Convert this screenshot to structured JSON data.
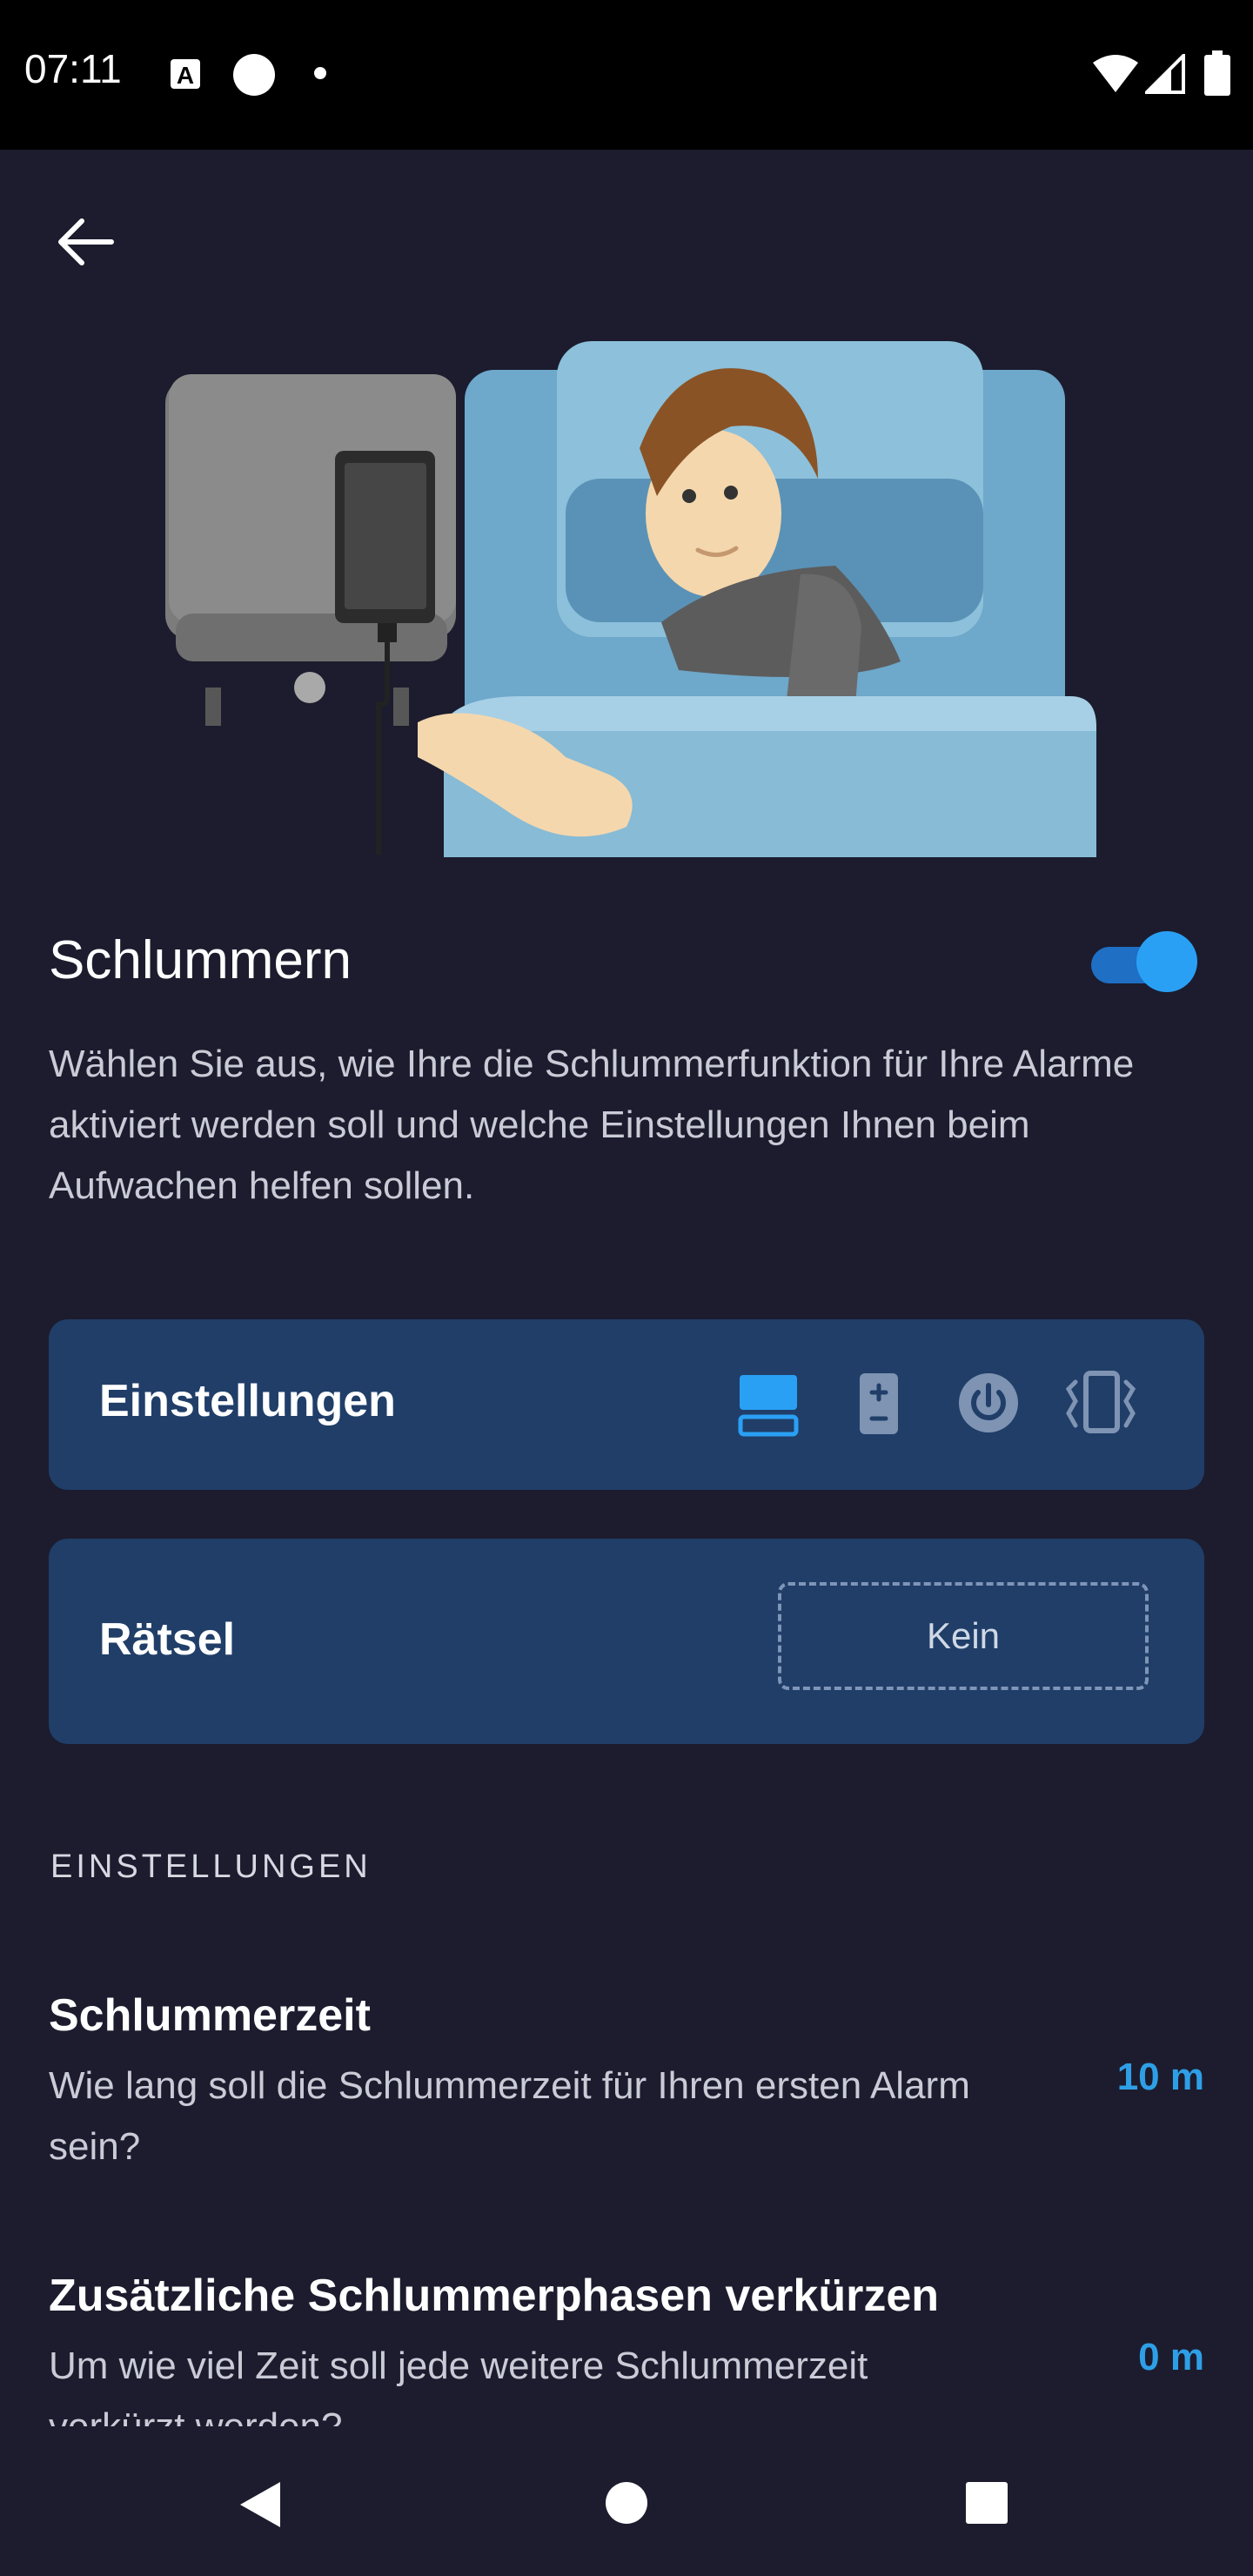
{
  "status_bar": {
    "time": "07:11",
    "icons": [
      "a-font-icon",
      "circle-icon",
      "dot-icon",
      "wifi-icon",
      "signal-icon",
      "battery-icon"
    ]
  },
  "header": {
    "back_icon": "arrow-left-icon"
  },
  "snooze": {
    "title": "Schlummern",
    "enabled": true,
    "description": "Wählen Sie aus, wie Ihre die Schlummerfunktion für Ihre Alarme aktiviert werden soll und welche Einstellungen Ihnen beim Aufwachen helfen sollen."
  },
  "settings_card": {
    "label": "Einstellungen",
    "icons": [
      "screen-button-icon",
      "volume-button-icon",
      "power-button-icon",
      "shake-icon"
    ],
    "active_icon": "screen-button-icon"
  },
  "puzzle_card": {
    "label": "Rätsel",
    "value": "Kein"
  },
  "section": {
    "header": "EINSTELLUNGEN"
  },
  "items": [
    {
      "title": "Schlummerzeit",
      "description": "Wie lang soll die Schlummerzeit für Ihren ersten Alarm sein?",
      "value": "10 m"
    },
    {
      "title": "Zusätzliche Schlummerphasen verkürzen",
      "description": "Um wie viel Zeit soll jede weitere Schlummerzeit verkürzt werden?",
      "value": "0 m"
    }
  ],
  "nav": {
    "icons": [
      "back-triangle-icon",
      "home-circle-icon",
      "recents-square-icon"
    ]
  },
  "colors": {
    "background": "#1c1c2e",
    "card": "#203e68",
    "accent": "#2aa0f5",
    "value_text": "#2e9fe6"
  }
}
